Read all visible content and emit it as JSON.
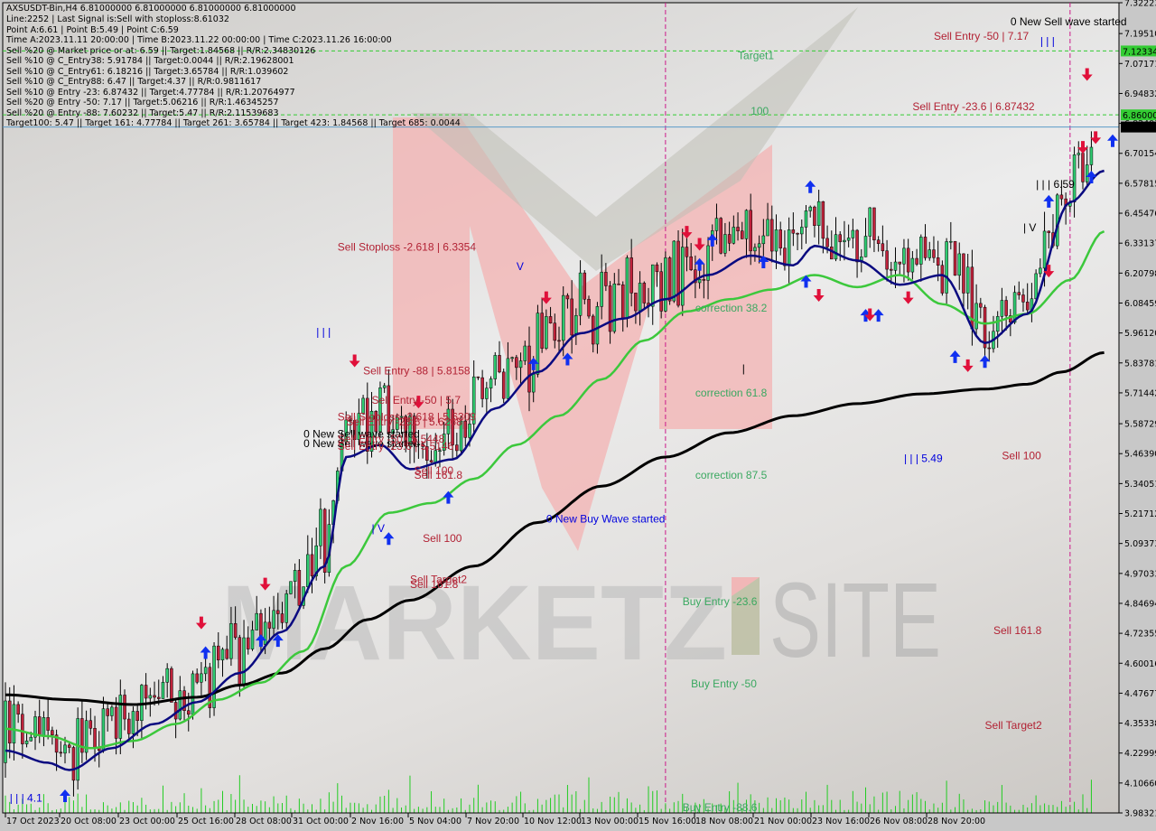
{
  "header": {
    "symbol_line": "AXSUSDT-Bin,H4  6.81000000 6.81000000 6.81000000 6.81000000",
    "lines": [
      "Line:2252 | Last Signal is:Sell with stoploss:8.61032",
      "Point A:6.61 | Point B:5.49 | Point C:6.59",
      "Time A:2023.11.11 20:00:00 | Time B:2023.11.22 00:00:00 | Time C:2023.11.26 16:00:00",
      "Sell %20 @ Market price or at: 6.59 || Target:1.84568 || R/R:2.34830126",
      "Sell %10 @ C_Entry38: 5.91784 || Target:0.0044 || R/R:2.19628001",
      "Sell %10 @ C_Entry61: 6.18216 || Target:3.65784 || R/R:1.039602",
      "Sell %10 @ C_Entry88: 6.47 || Target:4.37 || R/R:0.9811617",
      "Sell %10 @ Entry -23: 6.87432 || Target:4.77784 || R/R:1.20764977",
      "Sell %20 @ Entry -50: 7.17 || Target:5.06216 || R/R:1.46345257",
      "Sell %20 @ Entry -88: 7.60232 || Target:5.47 || R/R:2.11539683",
      "Target100: 5.47 || Target 161: 4.77784 || Target 261: 3.65784 || Target 423: 1.84568 || Target 685: 0.0044"
    ]
  },
  "colors": {
    "bull": "#2ecc71",
    "bear": "#c0223b",
    "ma_fast": "#0a0a80",
    "ma_mid": "#3cc83c",
    "ma_slow": "#000000",
    "sell_text": "#b22234",
    "buy_text": "#3aa860",
    "blue_text": "#0000dd",
    "vline": "#cc1a8a",
    "hline_green": "#33cc33",
    "hline_price": "#5b9bc8",
    "price_tag_bg": "#000000",
    "green_tag_bg": "#33cc33",
    "watermark_red": "#f2b5b5"
  },
  "watermark": {
    "text_left": "MARKETZ",
    "text_right": "SITE"
  },
  "chart_data": {
    "type": "candlestick",
    "title": "AXSUSDT-Bin,H4",
    "ylim": [
      3.983217,
      7.322233
    ],
    "y_ticks": [
      "7.32223",
      "7.19510",
      "7.07171",
      "6.94832",
      "6.82493",
      "6.70154",
      "6.57815",
      "6.45476",
      "6.33137",
      "6.20798",
      "6.08459",
      "5.96120",
      "5.83781",
      "5.71442",
      "5.58729",
      "5.46390",
      "5.34051",
      "5.21712",
      "5.09373",
      "4.97033",
      "4.84694",
      "4.72355",
      "4.60016",
      "4.47677",
      "4.35338",
      "4.22999",
      "4.10660",
      "3.98321"
    ],
    "y_tick_values": [
      7.32223,
      7.1951,
      7.07171,
      6.94832,
      6.82493,
      6.70154,
      6.57815,
      6.45476,
      6.33137,
      6.20798,
      6.08459,
      5.9612,
      5.83781,
      5.71442,
      5.58729,
      5.4639,
      5.34051,
      5.21712,
      5.09373,
      4.97033,
      4.84694,
      4.72355,
      4.60016,
      4.47677,
      4.35338,
      4.22999,
      4.1066,
      3.98321
    ],
    "price_tags": [
      {
        "label": "7.12334",
        "value": 7.12334,
        "kind": "green"
      },
      {
        "label": "6.86000",
        "value": 6.86,
        "kind": "green"
      },
      {
        "label": "6.81000",
        "value": 6.81,
        "kind": "current"
      }
    ],
    "x_ticks": [
      "17 Oct 2023",
      "20 Oct 08:00",
      "23 Oct 00:00",
      "25 Oct 16:00",
      "28 Oct 08:00",
      "31 Oct 00:00",
      "2 Nov 16:00",
      "5 Nov 04:00",
      "7 Nov 20:00",
      "10 Nov 12:00",
      "13 Nov 00:00",
      "15 Nov 16:00",
      "18 Nov 08:00",
      "21 Nov 00:00",
      "23 Nov 16:00",
      "26 Nov 08:00",
      "28 Nov 20:00"
    ],
    "bars_total": 256,
    "h_lines": [
      {
        "value": 7.12334,
        "style": "green-dash"
      },
      {
        "value": 6.86,
        "style": "green-dash"
      },
      {
        "value": 6.81,
        "style": "price"
      }
    ],
    "v_lines": [
      {
        "bar_index": 155
      },
      {
        "bar_index": 250
      }
    ],
    "ma_slow": [
      [
        0,
        4.47
      ],
      [
        15,
        4.45
      ],
      [
        30,
        4.43
      ],
      [
        45,
        4.46
      ],
      [
        55,
        4.51
      ],
      [
        65,
        4.56
      ],
      [
        75,
        4.66
      ],
      [
        85,
        4.78
      ],
      [
        95,
        4.86
      ],
      [
        110,
        5.0
      ],
      [
        125,
        5.18
      ],
      [
        140,
        5.33
      ],
      [
        155,
        5.45
      ],
      [
        170,
        5.55
      ],
      [
        185,
        5.62
      ],
      [
        200,
        5.67
      ],
      [
        215,
        5.71
      ],
      [
        230,
        5.73
      ],
      [
        240,
        5.75
      ],
      [
        248,
        5.8
      ],
      [
        258,
        5.88
      ]
    ],
    "ma_mid": [
      [
        0,
        4.33
      ],
      [
        10,
        4.3
      ],
      [
        20,
        4.25
      ],
      [
        30,
        4.28
      ],
      [
        40,
        4.35
      ],
      [
        50,
        4.45
      ],
      [
        60,
        4.52
      ],
      [
        70,
        4.65
      ],
      [
        80,
        5.0
      ],
      [
        90,
        5.22
      ],
      [
        100,
        5.26
      ],
      [
        110,
        5.36
      ],
      [
        120,
        5.5
      ],
      [
        130,
        5.62
      ],
      [
        140,
        5.77
      ],
      [
        150,
        5.93
      ],
      [
        160,
        6.05
      ],
      [
        170,
        6.1
      ],
      [
        180,
        6.14
      ],
      [
        190,
        6.2
      ],
      [
        200,
        6.15
      ],
      [
        210,
        6.2
      ],
      [
        220,
        6.08
      ],
      [
        230,
        6.0
      ],
      [
        240,
        6.04
      ],
      [
        250,
        6.18
      ],
      [
        258,
        6.38
      ]
    ],
    "ma_fast": [
      [
        0,
        4.24
      ],
      [
        10,
        4.19
      ],
      [
        15,
        4.16
      ],
      [
        25,
        4.25
      ],
      [
        35,
        4.35
      ],
      [
        45,
        4.44
      ],
      [
        55,
        4.56
      ],
      [
        65,
        4.73
      ],
      [
        75,
        5.0
      ],
      [
        80,
        5.45
      ],
      [
        88,
        5.5
      ],
      [
        95,
        5.4
      ],
      [
        105,
        5.44
      ],
      [
        115,
        5.65
      ],
      [
        125,
        5.8
      ],
      [
        135,
        5.96
      ],
      [
        145,
        6.02
      ],
      [
        155,
        6.1
      ],
      [
        165,
        6.2
      ],
      [
        175,
        6.28
      ],
      [
        185,
        6.24
      ],
      [
        190,
        6.32
      ],
      [
        200,
        6.26
      ],
      [
        210,
        6.16
      ],
      [
        220,
        6.2
      ],
      [
        230,
        5.92
      ],
      [
        240,
        6.04
      ],
      [
        250,
        6.5
      ],
      [
        258,
        6.63
      ]
    ],
    "candles_seed": 42,
    "annotations": [
      {
        "text": "Target1",
        "bar": 172,
        "value": 7.09,
        "color": "buy"
      },
      {
        "text": "100",
        "bar": 175,
        "value": 6.86,
        "color": "buy"
      },
      {
        "text": "Sell Entry -50 | 7.17",
        "bar": 218,
        "value": 7.17,
        "color": "sell"
      },
      {
        "text": "Sell Entry -23.6 | 6.87432",
        "bar": 213,
        "value": 6.88,
        "color": "sell"
      },
      {
        "text": "0 New Sell wave started",
        "bar": 236,
        "value": 7.23,
        "color": "black"
      },
      {
        "text": "Sell Stoploss -2.618 | 6.3354",
        "bar": 78,
        "value": 6.3,
        "color": "sell"
      },
      {
        "text": "Sell Entry -88 | 5.8158",
        "bar": 84,
        "value": 5.79,
        "color": "sell"
      },
      {
        "text": "Sell Entry -50 | 5.7",
        "bar": 86,
        "value": 5.67,
        "color": "sell"
      },
      {
        "text": "Sell Stoploss -2.618 | 5.6309",
        "bar": 78,
        "value": 5.6,
        "color": "sell"
      },
      {
        "text": "Sell Entry -23.6 | 5.6268",
        "bar": 80,
        "value": 5.58,
        "color": "sell"
      },
      {
        "text": "0 New Sell wave started",
        "bar": 70,
        "value": 5.53,
        "color": "black"
      },
      {
        "text": "0 New Sell wave started",
        "bar": 70,
        "value": 5.49,
        "color": "black"
      },
      {
        "text": "Sell Entry -50 | 5.5448",
        "bar": 78,
        "value": 5.51,
        "color": "sell"
      },
      {
        "text": "Sell Entry -23.6 | 5.5146",
        "bar": 78,
        "value": 5.48,
        "color": "sell"
      },
      {
        "text": "Sell 100",
        "bar": 96,
        "value": 5.38,
        "color": "sell"
      },
      {
        "text": "Sell 161.8",
        "bar": 96,
        "value": 5.36,
        "color": "sell"
      },
      {
        "text": "Sell 100",
        "bar": 98,
        "value": 5.1,
        "color": "sell"
      },
      {
        "text": "Sell Target2",
        "bar": 95,
        "value": 4.93,
        "color": "sell"
      },
      {
        "text": "Sell 161.8",
        "bar": 95,
        "value": 4.91,
        "color": "sell"
      },
      {
        "text": "0 New Buy Wave started",
        "bar": 127,
        "value": 5.18,
        "color": "blue"
      },
      {
        "text": "correction 38.2",
        "bar": 162,
        "value": 6.05,
        "color": "buy"
      },
      {
        "text": "correction 61.8",
        "bar": 162,
        "value": 5.7,
        "color": "buy"
      },
      {
        "text": "correction 87.5",
        "bar": 162,
        "value": 5.36,
        "color": "buy"
      },
      {
        "text": "Buy Entry -23.6",
        "bar": 159,
        "value": 4.84,
        "color": "buy"
      },
      {
        "text": "Buy Entry -50",
        "bar": 161,
        "value": 4.5,
        "color": "buy"
      },
      {
        "text": "Buy Entry -88.6",
        "bar": 159,
        "value": 3.99,
        "color": "buy"
      },
      {
        "text": "Sell 100",
        "bar": 234,
        "value": 5.44,
        "color": "sell"
      },
      {
        "text": "Sell 161.8",
        "bar": 232,
        "value": 4.72,
        "color": "sell"
      },
      {
        "text": "Sell Target2",
        "bar": 230,
        "value": 4.33,
        "color": "sell"
      },
      {
        "text": "| | | 6.59",
        "bar": 242,
        "value": 6.56,
        "color": "black",
        "big": true
      },
      {
        "text": "| V",
        "bar": 239,
        "value": 6.38,
        "color": "black",
        "big": true
      },
      {
        "text": "| | | 5.49",
        "bar": 211,
        "value": 5.43,
        "color": "blue",
        "big": true
      },
      {
        "text": "| | | 4.1",
        "bar": 1,
        "value": 4.03,
        "color": "blue",
        "big": true
      },
      {
        "text": "| V",
        "bar": 86,
        "value": 5.14,
        "color": "blue",
        "big": true
      },
      {
        "text": "V",
        "bar": 120,
        "value": 6.22,
        "color": "blue",
        "big": true
      },
      {
        "text": "| | |",
        "bar": 73,
        "value": 5.95,
        "color": "blue",
        "big": true
      },
      {
        "text": "| | |",
        "bar": 243,
        "value": 7.15,
        "color": "blue",
        "big": true
      },
      {
        "text": "|",
        "bar": 173,
        "value": 5.8,
        "color": "black",
        "big": true
      }
    ],
    "arrows_up": [
      [
        14,
        4.05
      ],
      [
        47,
        4.64
      ],
      [
        60,
        4.69
      ],
      [
        64,
        4.69
      ],
      [
        90,
        5.11
      ],
      [
        104,
        5.28
      ],
      [
        124,
        5.83
      ],
      [
        132,
        5.85
      ],
      [
        163,
        6.24
      ],
      [
        166,
        6.34
      ],
      [
        178,
        6.25
      ],
      [
        188,
        6.17
      ],
      [
        202,
        6.03
      ],
      [
        205,
        6.03
      ],
      [
        223,
        5.86
      ],
      [
        230,
        5.84
      ],
      [
        245,
        6.5
      ],
      [
        255,
        6.6
      ],
      [
        260,
        6.75
      ],
      [
        189,
        6.56
      ]
    ],
    "arrows_down": [
      [
        46,
        4.77
      ],
      [
        61,
        4.93
      ],
      [
        82,
        5.85
      ],
      [
        97,
        5.68
      ],
      [
        127,
        6.11
      ],
      [
        160,
        6.38
      ],
      [
        163,
        6.33
      ],
      [
        191,
        6.12
      ],
      [
        203,
        6.04
      ],
      [
        212,
        6.11
      ],
      [
        226,
        5.83
      ],
      [
        245,
        6.22
      ],
      [
        253,
        6.73
      ],
      [
        256,
        6.77
      ],
      [
        254,
        7.03
      ]
    ]
  }
}
